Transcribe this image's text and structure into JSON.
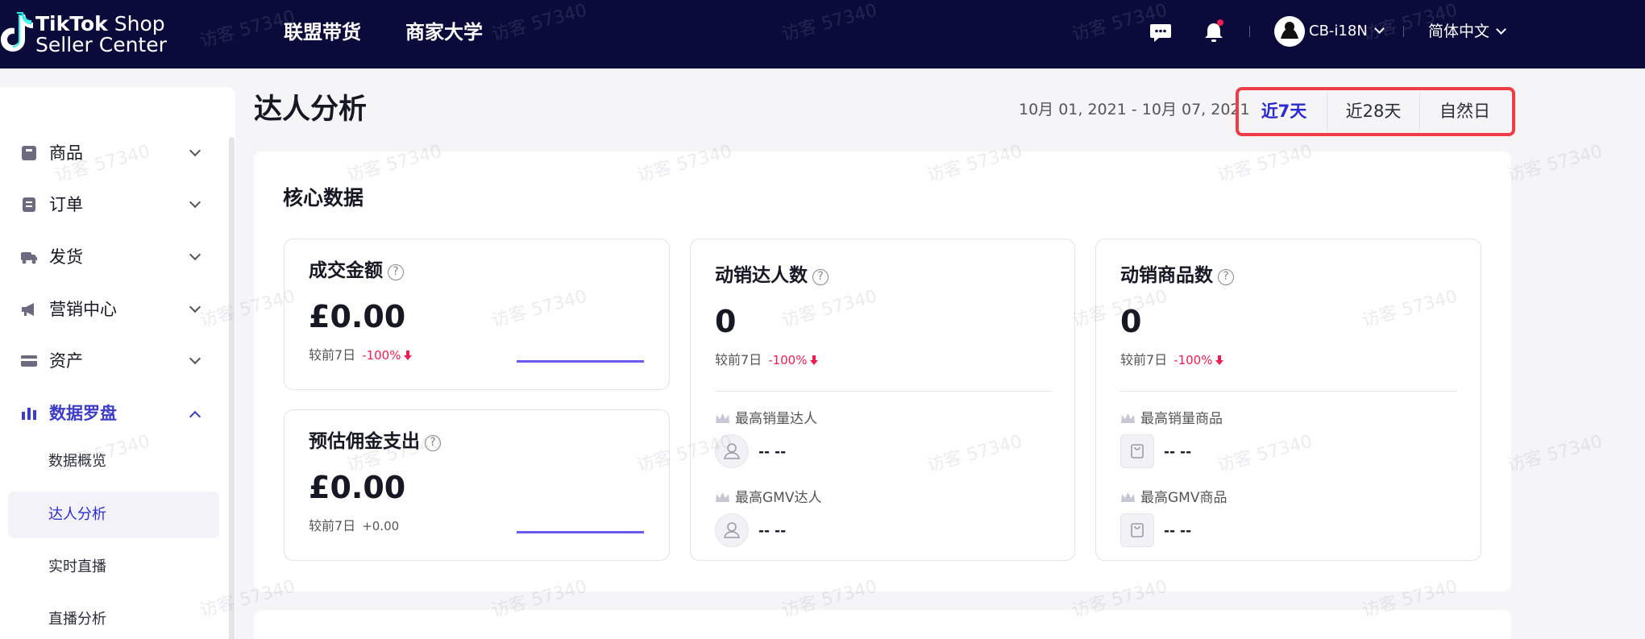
{
  "brand": {
    "line1_bold": "TikTok",
    "line1_rest": " Shop",
    "line2": "Seller Center"
  },
  "topnav": [
    "联盟带货",
    "商家大学"
  ],
  "header": {
    "account": "CB-i18N",
    "language": "简体中文"
  },
  "sidebar": {
    "items": [
      {
        "label": "商品",
        "icon": "box-icon"
      },
      {
        "label": "订单",
        "icon": "order-icon"
      },
      {
        "label": "发货",
        "icon": "truck-icon"
      },
      {
        "label": "营销中心",
        "icon": "megaphone-icon"
      },
      {
        "label": "资产",
        "icon": "card-icon"
      },
      {
        "label": "数据罗盘",
        "icon": "bar-chart-icon"
      }
    ],
    "sub_items": [
      "数据概览",
      "达人分析",
      "实时直播",
      "直播分析"
    ]
  },
  "page": {
    "title": "达人分析",
    "date_range": "10月 01, 2021 - 10月 07, 2021",
    "periods": [
      "近7天",
      "近28天",
      "自然日"
    ]
  },
  "core": {
    "title": "核心数据",
    "gmv": {
      "title": "成交金额",
      "value": "£0.00",
      "compare_label": "较前7日",
      "change": "-100%"
    },
    "commission": {
      "title": "预估佣金支出",
      "value": "£0.00",
      "compare_label": "较前7日",
      "change": "+0.00"
    },
    "creators": {
      "title": "动销达人数",
      "value": "0",
      "compare_label": "较前7日",
      "change": "-100%",
      "top_sales_label": "最高销量达人",
      "top_sales_value": "-- --",
      "top_gmv_label": "最高GMV达人",
      "top_gmv_value": "-- --"
    },
    "products": {
      "title": "动销商品数",
      "value": "0",
      "compare_label": "较前7日",
      "change": "-100%",
      "top_sales_label": "最高销量商品",
      "top_sales_value": "-- --",
      "top_gmv_label": "最高GMV商品",
      "top_gmv_value": "-- --"
    }
  },
  "watermark": "访客 57340",
  "colors": {
    "topbar": "#0b0b3b",
    "accent": "#2a2ad0",
    "negative": "#ee1d52",
    "highlight": "#ee3d46",
    "sparkline": "#6a5af0"
  }
}
